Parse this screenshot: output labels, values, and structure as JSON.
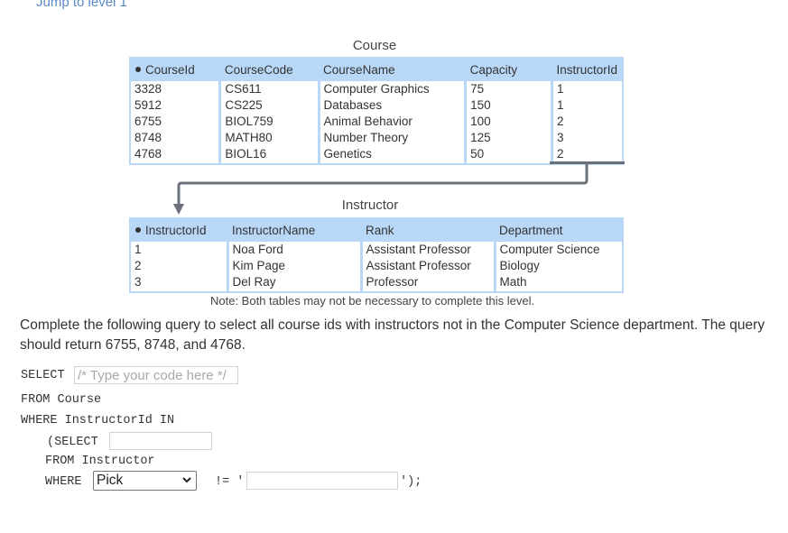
{
  "header": {
    "jump_link": "Jump to level 1"
  },
  "course_table": {
    "title": "Course",
    "primary_key": "CourseId",
    "columns": [
      "CourseId",
      "CourseCode",
      "CourseName",
      "Capacity",
      "InstructorId"
    ],
    "rows": [
      [
        "3328",
        "CS611",
        "Computer Graphics",
        "75",
        "1"
      ],
      [
        "5912",
        "CS225",
        "Databases",
        "150",
        "1"
      ],
      [
        "6755",
        "BIOL759",
        "Animal Behavior",
        "100",
        "2"
      ],
      [
        "8748",
        "MATH80",
        "Number Theory",
        "125",
        "3"
      ],
      [
        "4768",
        "BIOL16",
        "Genetics",
        "50",
        "2"
      ]
    ]
  },
  "instructor_table": {
    "title": "Instructor",
    "primary_key": "InstructorId",
    "columns": [
      "InstructorId",
      "InstructorName",
      "Rank",
      "Department"
    ],
    "rows": [
      [
        "1",
        "Noa Ford",
        "Assistant Professor",
        "Computer Science"
      ],
      [
        "2",
        "Kim Page",
        "Assistant Professor",
        "Biology"
      ],
      [
        "3",
        "Del Ray",
        "Professor",
        "Math"
      ]
    ]
  },
  "note": "Note: Both tables may not be necessary to complete this level.",
  "prompt": "Complete the following query to select all course ids with instructors not in the Computer Science department. The query should return 6755, 8748, and 4768.",
  "query": {
    "line1_keyword": "SELECT",
    "line1_input_placeholder": "/* Type your code here */",
    "line1_input_value": "",
    "line2": "FROM Course",
    "line3": "WHERE InstructorId IN",
    "line4_keyword": "(SELECT",
    "line4_input_value": "",
    "line5": "FROM Instructor",
    "line6_keyword": "WHERE",
    "line6_select_value": "Pick",
    "line6_operator": "!= '",
    "line6_input_value": "",
    "line6_end": "');"
  },
  "colors": {
    "table_header": "#b9d8f8",
    "link": "#5a8ac6",
    "fk_arrow": "#6b717a"
  }
}
